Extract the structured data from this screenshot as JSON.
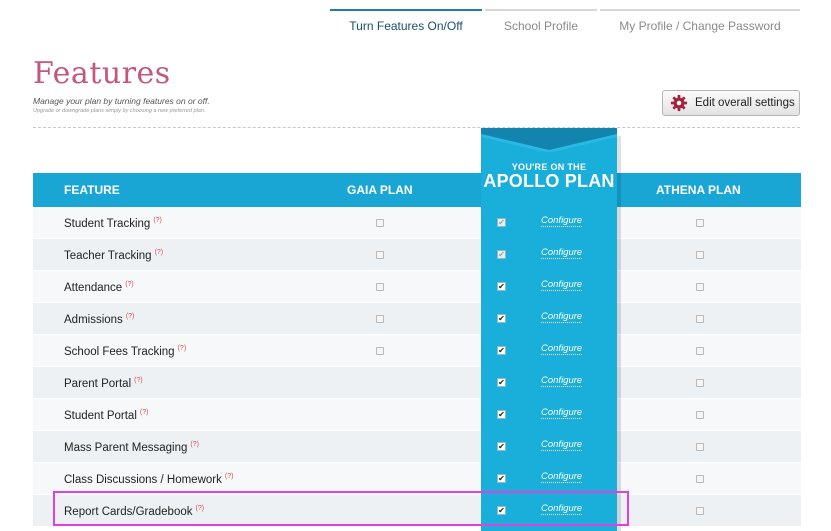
{
  "tabs": [
    {
      "label": "Turn Features On/Off",
      "active": true
    },
    {
      "label": "School Profile",
      "active": false
    },
    {
      "label": "My Profile / Change Password",
      "active": false
    }
  ],
  "page": {
    "title": "Features",
    "subtitle": "Manage your plan by turning features on or off.",
    "hint": "Upgrade or downgrade plans simply by choosing a new preferred plan."
  },
  "settings_button": {
    "label": "Edit overall settings",
    "icon": "gear-icon"
  },
  "table": {
    "headers": {
      "feature": "FEATURE",
      "gaia": "GAIA PLAN",
      "athena": "ATHENA PLAN"
    },
    "apollo": {
      "line1": "YOU'RE ON THE",
      "line2": "APOLLO PLAN"
    },
    "configure_label": "Configure",
    "help_mark": "(?)",
    "rows": [
      {
        "feature": "Student Tracking",
        "gaia": true,
        "apollo_dim": true
      },
      {
        "feature": "Teacher Tracking",
        "gaia": true,
        "apollo_dim": true
      },
      {
        "feature": "Attendance",
        "gaia": true,
        "apollo_dim": false
      },
      {
        "feature": "Admissions",
        "gaia": true,
        "apollo_dim": false
      },
      {
        "feature": "School Fees Tracking",
        "gaia": true,
        "apollo_dim": false
      },
      {
        "feature": "Parent Portal",
        "gaia": false,
        "apollo_dim": false
      },
      {
        "feature": "Student Portal",
        "gaia": false,
        "apollo_dim": false
      },
      {
        "feature": "Mass Parent Messaging",
        "gaia": false,
        "apollo_dim": false
      },
      {
        "feature": "Class Discussions / Homework",
        "gaia": false,
        "apollo_dim": false
      },
      {
        "feature": "Report Cards/Gradebook",
        "gaia": false,
        "apollo_dim": false
      }
    ]
  },
  "colors": {
    "accent": "#1aa6d4",
    "apollo": "#1aaedb",
    "title": "#c2587a",
    "highlight": "#e040e0"
  }
}
